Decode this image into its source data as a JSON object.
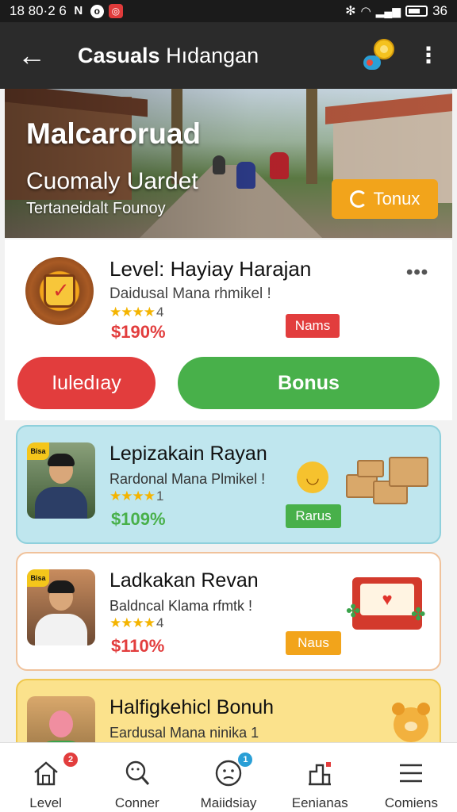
{
  "status_bar": {
    "time": "18 80·2 6",
    "battery": "36"
  },
  "header": {
    "title_bold": "Casuals",
    "title_rest": " Hıdangan"
  },
  "hero": {
    "title": "Malcaroruad",
    "subtitle": "Cuomaly Uardet",
    "caption": "Tertaneidalt Founoy",
    "button_label": "Tonux"
  },
  "level_card": {
    "title": "Level: Hayiay Harajan",
    "subtitle": "Daidusal Mana rhmikel !",
    "rating": "4",
    "price": "$190%",
    "tag": "Nams",
    "btn_left": "Iuledıay",
    "btn_right": "Bonus"
  },
  "offers": [
    {
      "title": "Lepizakain Rayan",
      "subtitle": "Rardonal Mana Plmikel !",
      "rating": "1",
      "price": "$109%",
      "tag": "Rarus",
      "photo_tag": "Bisa"
    },
    {
      "title": "Ladkakan Revan",
      "subtitle": "Baldncal Klama rfmtk !",
      "rating": "4",
      "price": "$110%",
      "tag": "Naus",
      "photo_tag": "Bisa"
    },
    {
      "title": "Halfigkehicl Bonuh",
      "subtitle": "Eardusal Mana ninika 1"
    }
  ],
  "nav": [
    {
      "label": "Level",
      "icon": "home-icon",
      "badge": "2"
    },
    {
      "label": "Conner",
      "icon": "search-icon"
    },
    {
      "label": "Maiidsiay",
      "icon": "face-icon",
      "badge": "1"
    },
    {
      "label": "Eenianas",
      "icon": "inbox-icon"
    },
    {
      "label": "Comiens",
      "icon": "menu-icon"
    }
  ],
  "colors": {
    "red": "#e23d3d",
    "green": "#48b04a",
    "orange": "#f2a41b",
    "cyan_card": "#bfe6ee",
    "yellow_card": "#fbe28c"
  }
}
